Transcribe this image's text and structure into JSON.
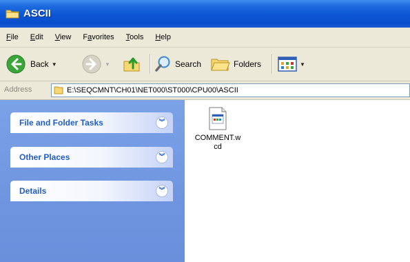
{
  "window": {
    "title": "ASCII"
  },
  "menubar": {
    "items": [
      {
        "accel": "F",
        "rest": "ile"
      },
      {
        "accel": "E",
        "rest": "dit"
      },
      {
        "accel": "V",
        "rest": "iew"
      },
      {
        "pre": "F",
        "accel": "a",
        "rest": "vorites"
      },
      {
        "accel": "T",
        "rest": "ools"
      },
      {
        "accel": "H",
        "rest": "elp"
      }
    ]
  },
  "toolbar": {
    "back_label": "Back",
    "search_label": "Search",
    "folders_label": "Folders"
  },
  "address": {
    "label": "Address",
    "path": "E:\\SEQCMNT\\CH01\\NET000\\ST000\\CPU00\\ASCII"
  },
  "taskpane": {
    "panels": [
      {
        "title": "File and Folder Tasks"
      },
      {
        "title": "Other Places"
      },
      {
        "title": "Details"
      }
    ]
  },
  "files": [
    {
      "name": "COMMENT.wcd",
      "icon": "document-icon"
    }
  ],
  "colors": {
    "titlebar": "#0b55d4",
    "chrome": "#ece9d8",
    "taskpane": "#6f95e0",
    "panel_title": "#215dc6"
  }
}
